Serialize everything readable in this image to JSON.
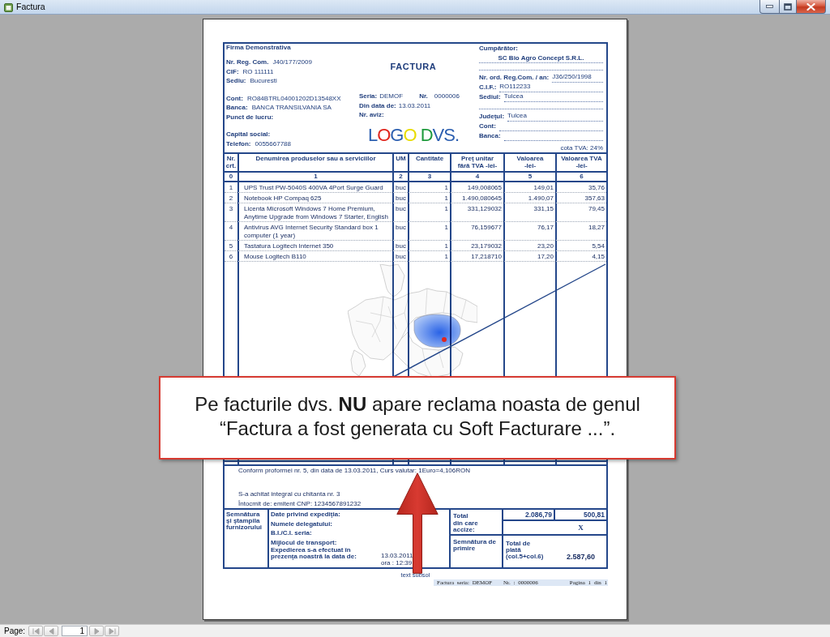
{
  "window": {
    "title": "Factura"
  },
  "invoice": {
    "supplier": {
      "name": "Firma Demonstrativa",
      "groups": [
        [
          {
            "label": "Nr. Reg. Com.",
            "value": "J40/177/2009"
          },
          {
            "label": "CIF:",
            "value": "RO 111111"
          },
          {
            "label": "Sediu:",
            "value": "Bucuresti"
          }
        ],
        [
          {
            "label": "Cont:",
            "value": "RO84BTRL04001202D13548XX"
          },
          {
            "label": "Banca:",
            "value": "BANCA TRANSILVANIA SA"
          },
          {
            "label": "Punct de lucru:"
          }
        ],
        [
          {
            "label": "Capital social:"
          },
          {
            "label": "Telefon:",
            "value": "0055667788"
          }
        ]
      ]
    },
    "document": {
      "title": "FACTURA",
      "series_label": "Seria:",
      "series": "DEMOF",
      "number_label": "Nr.",
      "number": "0000006",
      "date_label": "Din data de:",
      "date": "13.03.2011",
      "notice_label": "Nr. aviz:",
      "logo": "LOGO DVS."
    },
    "buyer": {
      "heading": "Cumpărător:",
      "lines": [
        {
          "kind": "name",
          "value": "SC Bio Agro Concept S.R.L."
        },
        {
          "kind": "blank"
        },
        {
          "kind": "field",
          "label": "Nr. ord. Reg.Com. / an:",
          "value": "J36/250/1998"
        },
        {
          "kind": "field",
          "label": "C.I.F.:",
          "value": "RO112233"
        },
        {
          "kind": "field",
          "label": "Sediul:",
          "value": "Tulcea"
        },
        {
          "kind": "blank"
        },
        {
          "kind": "field",
          "label": "Judeţul:",
          "value": "Tulcea"
        },
        {
          "kind": "field",
          "label": "Cont:"
        },
        {
          "kind": "field",
          "label": "Banca:"
        }
      ],
      "vat_rate": "cota TVA: 24%"
    },
    "table": {
      "columns": [
        {
          "label": "Nr. crt.",
          "number": "0"
        },
        {
          "label": "Denumirea produselor sau a serviciilor",
          "number": "1"
        },
        {
          "label": "UM",
          "number": "2"
        },
        {
          "label": "Cantitate",
          "number": "3"
        },
        {
          "label": "Preţ unitar fără TVA -lei-",
          "number": "4"
        },
        {
          "label": "Valoarea -lei-",
          "number": "5"
        },
        {
          "label": "Valoarea TVA -lei-",
          "number": "6"
        }
      ],
      "rows": [
        {
          "nr": "1",
          "name": "UPS Trust PW-5040S 400VA 4Port Surge Guard",
          "unit": "buc",
          "quantity": "1",
          "price": "149,008065",
          "value": "149,01",
          "vat": "35,76"
        },
        {
          "nr": "2",
          "name": "Notebook HP Compaq 625",
          "unit": "buc",
          "quantity": "1",
          "price": "1.490,080645",
          "value": "1.490,07",
          "vat": "357,63"
        },
        {
          "nr": "3",
          "name": "Licenta Microsoft Windows 7 Home Premium, Anytime Upgrade from Windows 7 Starter, English",
          "unit": "buc",
          "quantity": "1",
          "price": "331,129032",
          "value": "331,15",
          "vat": "79,45"
        },
        {
          "nr": "4",
          "name": "Antivirus AVG Internet Security Standard box 1 computer (1 year)",
          "unit": "buc",
          "quantity": "1",
          "price": "76,159677",
          "value": "76,17",
          "vat": "18,27"
        },
        {
          "nr": "5",
          "name": "Tastatura Logitech Internet 350",
          "unit": "buc",
          "quantity": "1",
          "price": "23,179032",
          "value": "23,20",
          "vat": "5,54"
        },
        {
          "nr": "6",
          "name": "Mouse Logitech B110",
          "unit": "buc",
          "quantity": "1",
          "price": "17,218710",
          "value": "17,20",
          "vat": "4,15"
        }
      ]
    },
    "notes": {
      "exchange": "Conform proformei nr. 5, din data de 13.03.2011, Curs valutar: 1Euro=4,106RON",
      "payment": "S-a achitat integral cu chitanta nr. 3",
      "issuer": "Întocmit de: emitent CNP: 1234567891232"
    },
    "footer": {
      "supplier_signature": "Semnătura şi ştampila furnizorului",
      "shipping": [
        "Date privind expediţia:",
        "Numele delegatului:",
        "B.I./C.I. seria:",
        "Mijlocul de transport:"
      ],
      "shipping_statement": "Expedierea s-a efectuat în prezenţa noastră la data de:",
      "shipping_date": "13.03.2011",
      "shipping_time": "ora : 12:39",
      "totals_label": "Total din care accize:",
      "total_value": "2.086,79",
      "total_vat": "500,81",
      "excise": "X",
      "receipt_signature": "Semnătura de primire",
      "grand_total_label": "Total de plată (col.5+col.6)",
      "grand_total": "2.587,60"
    },
    "footer_text": "text subsol",
    "page_footer": {
      "series": "Factura seria: DEMOF",
      "number": "Nr. : 0000006",
      "page": "Pagina 1 din 1"
    }
  },
  "callout": {
    "text": "Pe facturile dvs. **NU** apare reclama noasta de genul “Factura a fost generata cu Soft Facturare ...”."
  },
  "status_bar": {
    "label": "Page:",
    "buttons_before": [
      {
        "kind": "first",
        "disabled": true
      },
      {
        "kind": "previous",
        "disabled": true
      }
    ],
    "page": "1",
    "buttons_after": [
      {
        "kind": "next",
        "disabled": true
      },
      {
        "kind": "last",
        "disabled": true
      }
    ]
  }
}
